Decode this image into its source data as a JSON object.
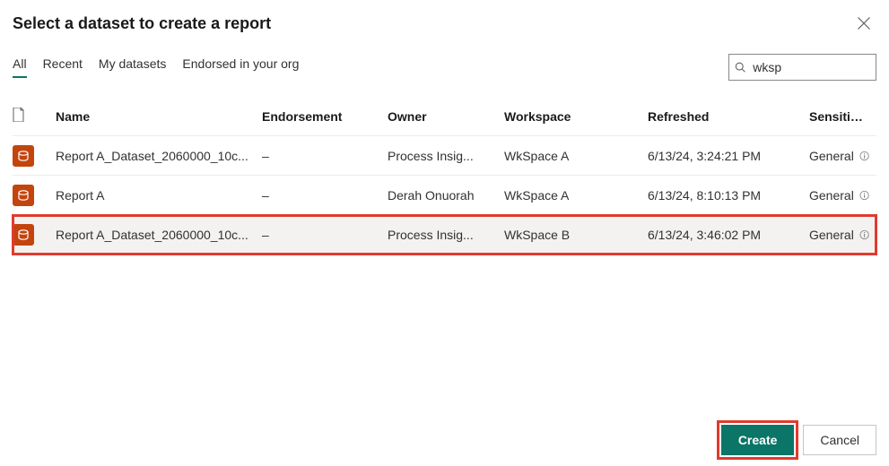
{
  "dialog": {
    "title": "Select a dataset to create a report"
  },
  "tabs": {
    "all": "All",
    "recent": "Recent",
    "my_datasets": "My datasets",
    "endorsed": "Endorsed in your org"
  },
  "search": {
    "value": "wksp"
  },
  "columns": {
    "name": "Name",
    "endorsement": "Endorsement",
    "owner": "Owner",
    "workspace": "Workspace",
    "refreshed": "Refreshed",
    "sensitivity": "Sensitivity"
  },
  "rows": [
    {
      "name": "Report A_Dataset_2060000_10c...",
      "endorsement": "–",
      "owner": "Process Insig...",
      "workspace": "WkSpace A",
      "refreshed": "6/13/24, 3:24:21 PM",
      "sensitivity": "General"
    },
    {
      "name": "Report A",
      "endorsement": "–",
      "owner": "Derah Onuorah",
      "workspace": "WkSpace A",
      "refreshed": "6/13/24, 8:10:13 PM",
      "sensitivity": "General"
    },
    {
      "name": "Report A_Dataset_2060000_10c...",
      "endorsement": "–",
      "owner": "Process Insig...",
      "workspace": "WkSpace B",
      "refreshed": "6/13/24, 3:46:02 PM",
      "sensitivity": "General"
    }
  ],
  "footer": {
    "create": "Create",
    "cancel": "Cancel"
  }
}
